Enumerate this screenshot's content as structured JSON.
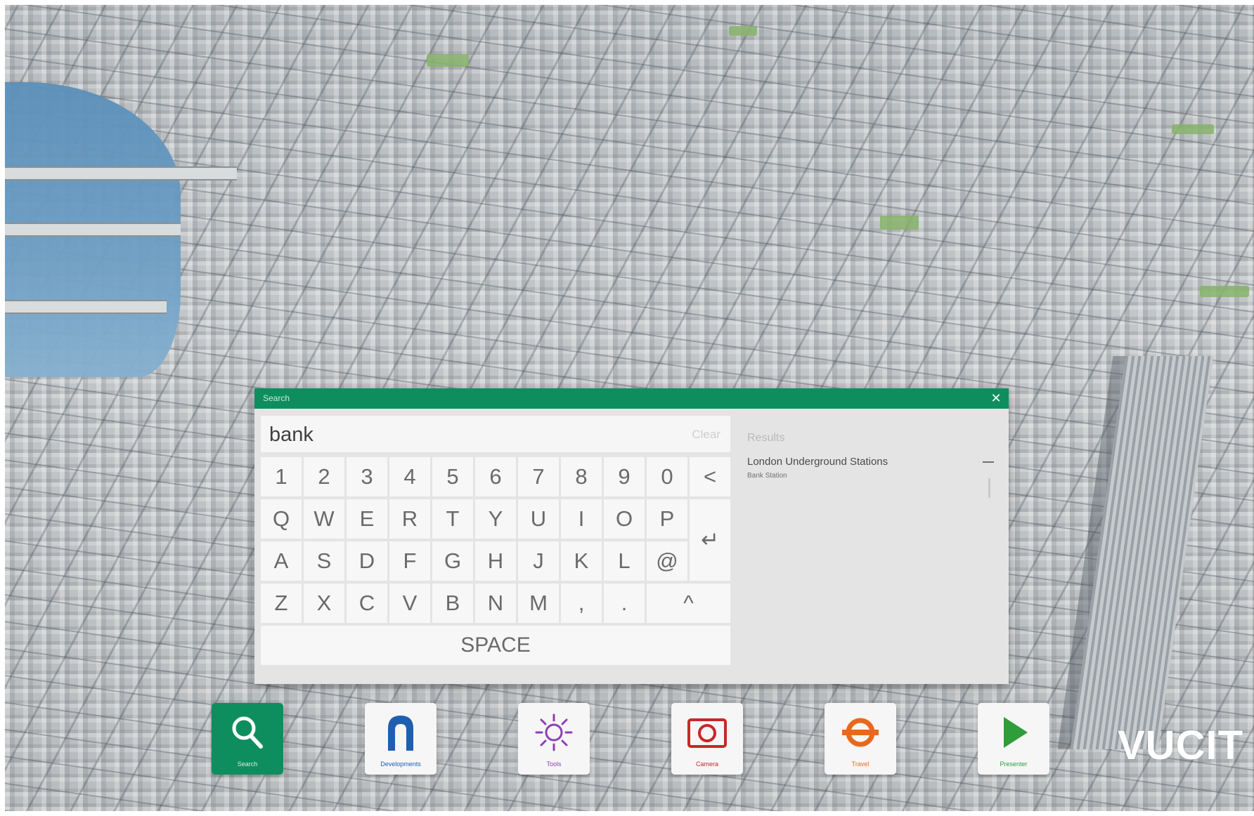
{
  "search_dialog": {
    "title": "Search",
    "query": "bank",
    "clear_label": "Clear",
    "results_label": "Results",
    "results": [
      {
        "group": "London Underground Stations",
        "items": [
          "Bank Station"
        ]
      }
    ]
  },
  "keyboard": {
    "rows": [
      [
        "1",
        "2",
        "3",
        "4",
        "5",
        "6",
        "7",
        "8",
        "9",
        "0",
        "<"
      ],
      [
        "Q",
        "W",
        "E",
        "R",
        "T",
        "Y",
        "U",
        "I",
        "O",
        "P"
      ],
      [
        "A",
        "S",
        "D",
        "F",
        "G",
        "H",
        "J",
        "K",
        "L",
        "@"
      ],
      [
        "Z",
        "X",
        "C",
        "V",
        "B",
        "N",
        "M",
        ",",
        "."
      ]
    ],
    "enter_key": "↵",
    "shift_key": "^",
    "space_label": "SPACE"
  },
  "toolbar": {
    "items": [
      {
        "id": "search",
        "label": "Search",
        "icon": "search-icon",
        "active": true,
        "color": "#ffffff"
      },
      {
        "id": "developments",
        "label": "Developments",
        "icon": "developments-icon",
        "active": false,
        "color": "#1f5fb0"
      },
      {
        "id": "tools",
        "label": "Tools",
        "icon": "sun-icon",
        "active": false,
        "color": "#8e3fb5"
      },
      {
        "id": "camera",
        "label": "Camera",
        "icon": "camera-icon",
        "active": false,
        "color": "#c62828"
      },
      {
        "id": "travel",
        "label": "Travel",
        "icon": "roundel-icon",
        "active": false,
        "color": "#e8691b"
      },
      {
        "id": "presenter",
        "label": "Presenter",
        "icon": "play-icon",
        "active": false,
        "color": "#2e9e3a"
      }
    ]
  },
  "brand": "VUCIT",
  "colors": {
    "accent": "#0e8e5f",
    "panel": "#e4e4e4",
    "key": "#f7f7f7"
  }
}
